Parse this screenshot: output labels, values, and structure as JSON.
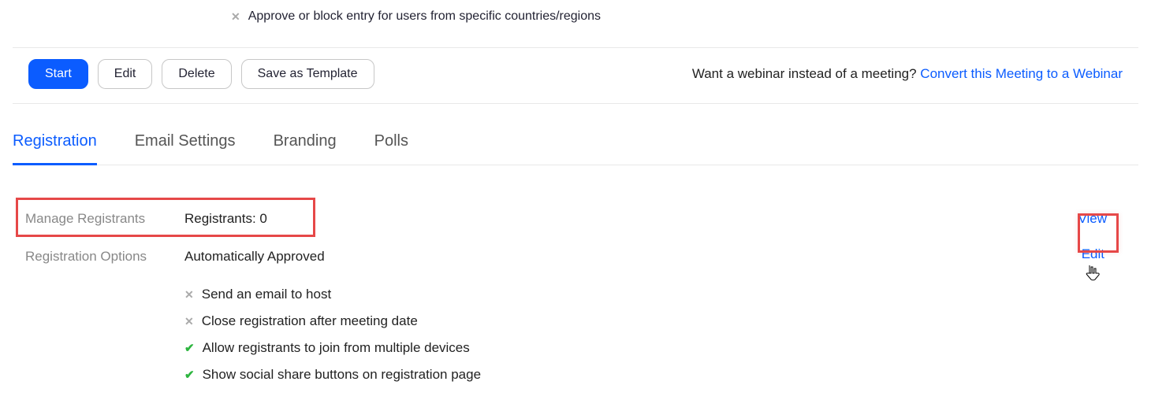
{
  "topOption": {
    "status": "x",
    "text": "Approve or block entry for users from specific countries/regions"
  },
  "actionButtons": {
    "start": "Start",
    "edit": "Edit",
    "delete": "Delete",
    "saveTemplate": "Save as Template"
  },
  "convert": {
    "prompt": "Want a webinar instead of a meeting? ",
    "link": "Convert this Meeting to a Webinar"
  },
  "tabs": [
    {
      "label": "Registration",
      "active": true
    },
    {
      "label": "Email Settings",
      "active": false
    },
    {
      "label": "Branding",
      "active": false
    },
    {
      "label": "Polls",
      "active": false
    }
  ],
  "manageRegistrants": {
    "label": "Manage Registrants",
    "value": "Registrants: 0",
    "action": "View"
  },
  "registrationOptions": {
    "label": "Registration Options",
    "value": "Automatically Approved",
    "action": "Edit",
    "items": [
      {
        "status": "x",
        "text": "Send an email to host"
      },
      {
        "status": "x",
        "text": "Close registration after meeting date"
      },
      {
        "status": "check",
        "text": "Allow registrants to join from multiple devices"
      },
      {
        "status": "check",
        "text": "Show social share buttons on registration page"
      }
    ]
  }
}
